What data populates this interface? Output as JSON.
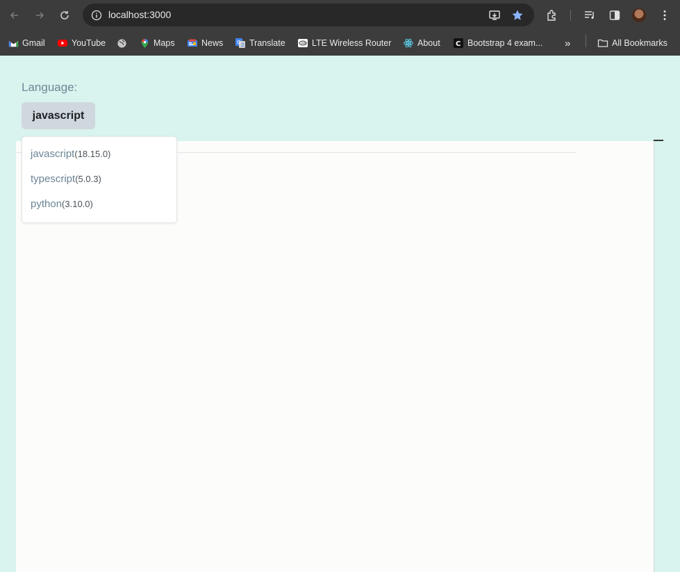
{
  "browser": {
    "url": "localhost:3000",
    "bookmarks": [
      {
        "label": "Gmail",
        "icon": "gmail-icon"
      },
      {
        "label": "YouTube",
        "icon": "youtube-icon"
      },
      {
        "label": "",
        "icon": "globe-icon"
      },
      {
        "label": "Maps",
        "icon": "maps-icon"
      },
      {
        "label": "News",
        "icon": "news-icon"
      },
      {
        "label": "Translate",
        "icon": "translate-icon"
      },
      {
        "label": "LTE Wireless Router",
        "icon": "router-icon"
      },
      {
        "label": "About",
        "icon": "react-icon"
      },
      {
        "label": "Bootstrap 4 exam...",
        "icon": "codepen-icon"
      }
    ],
    "overflow_label": "»",
    "all_bookmarks_label": "All Bookmarks"
  },
  "page": {
    "language_label": "Language:",
    "selected_language": "javascript",
    "options": [
      {
        "name": "javascript",
        "version": "(18.15.0)"
      },
      {
        "name": "typescript",
        "version": "(5.0.3)"
      },
      {
        "name": "python",
        "version": "(3.10.0)"
      }
    ]
  },
  "colors": {
    "page_background": "#d9f3ee",
    "chrome_background": "#3c3c3c",
    "button_background": "#cfd8de",
    "star_accent": "#8ab4f8"
  }
}
